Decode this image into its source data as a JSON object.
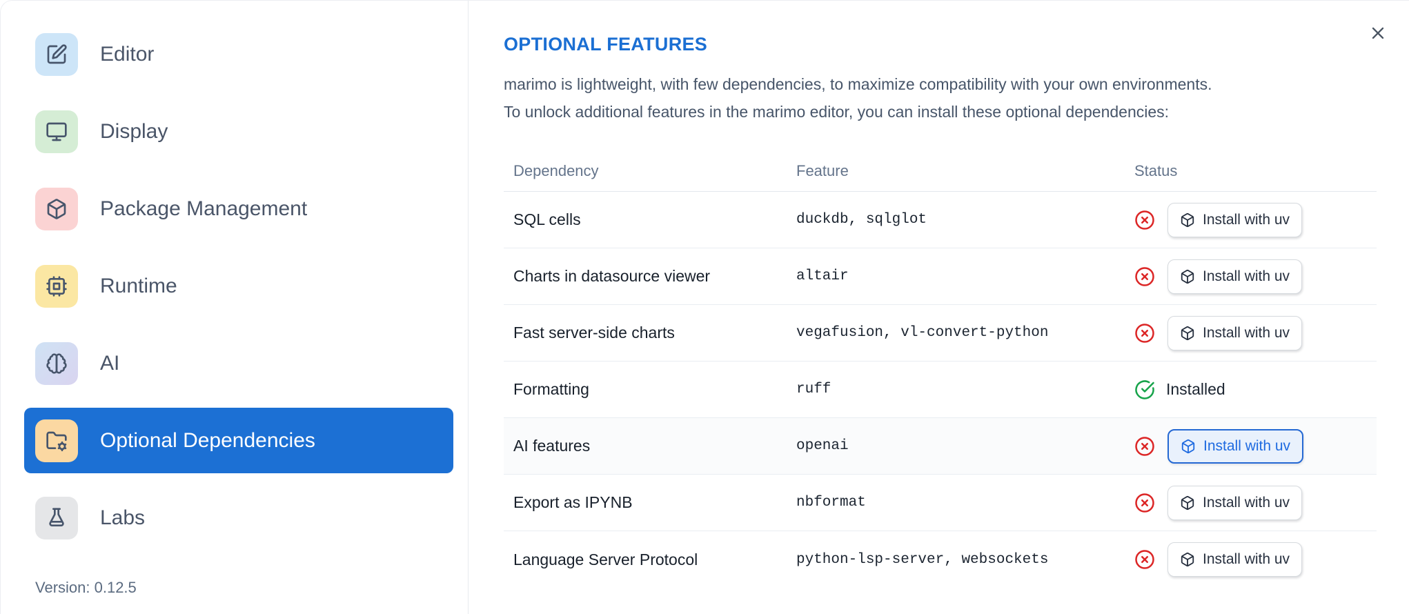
{
  "sidebar": {
    "items": [
      {
        "label": "Editor",
        "icon": "square-pen-icon",
        "icon_bg": "#cde5f8",
        "selected": false
      },
      {
        "label": "Display",
        "icon": "monitor-icon",
        "icon_bg": "#d5edd5",
        "selected": false
      },
      {
        "label": "Package Management",
        "icon": "package-icon",
        "icon_bg": "#fbd3d3",
        "selected": false
      },
      {
        "label": "Runtime",
        "icon": "cpu-icon",
        "icon_bg": "#fbe7a3",
        "selected": false
      },
      {
        "label": "AI",
        "icon": "brain-icon",
        "icon_bg": "linear-gradient(135deg,#cfe2f4 0%,#d9d4f0 100%)",
        "selected": false
      },
      {
        "label": "Optional Dependencies",
        "icon": "folder-cog-icon",
        "icon_bg": "#fbd8a2",
        "selected": true
      },
      {
        "label": "Labs",
        "icon": "flask-icon",
        "icon_bg": "#e5e6e8",
        "selected": false
      }
    ],
    "version_label": "Version: 0.12.5"
  },
  "dialog": {
    "title": "OPTIONAL FEATURES",
    "description_lines": [
      "marimo is lightweight, with few dependencies, to maximize compatibility with your own environments.",
      "To unlock additional features in the marimo editor, you can install these optional dependencies:"
    ],
    "close_icon": "close-icon"
  },
  "table": {
    "headers": [
      "Dependency",
      "Feature",
      "Status"
    ],
    "install_button_label": "Install with uv",
    "installed_label": "Installed",
    "rows": [
      {
        "dependency": "SQL cells",
        "feature": "duckdb, sqlglot",
        "installed": false,
        "focused": false
      },
      {
        "dependency": "Charts in datasource viewer",
        "feature": "altair",
        "installed": false,
        "focused": false
      },
      {
        "dependency": "Fast server-side charts",
        "feature": "vegafusion, vl-convert-python",
        "installed": false,
        "focused": false
      },
      {
        "dependency": "Formatting",
        "feature": "ruff",
        "installed": true,
        "focused": false
      },
      {
        "dependency": "AI features",
        "feature": "openai",
        "installed": false,
        "focused": true
      },
      {
        "dependency": "Export as IPYNB",
        "feature": "nbformat",
        "installed": false,
        "focused": false
      },
      {
        "dependency": "Language Server Protocol",
        "feature": "python-lsp-server, websockets",
        "installed": false,
        "focused": false
      }
    ]
  },
  "colors": {
    "accent_blue": "#1c70d4",
    "title_blue": "#1b6fd3",
    "status_missing_red": "#dc2626",
    "status_installed_green": "#16a34a",
    "focused_button_border": "#2468d3",
    "focused_button_bg": "#e9f1fc"
  }
}
